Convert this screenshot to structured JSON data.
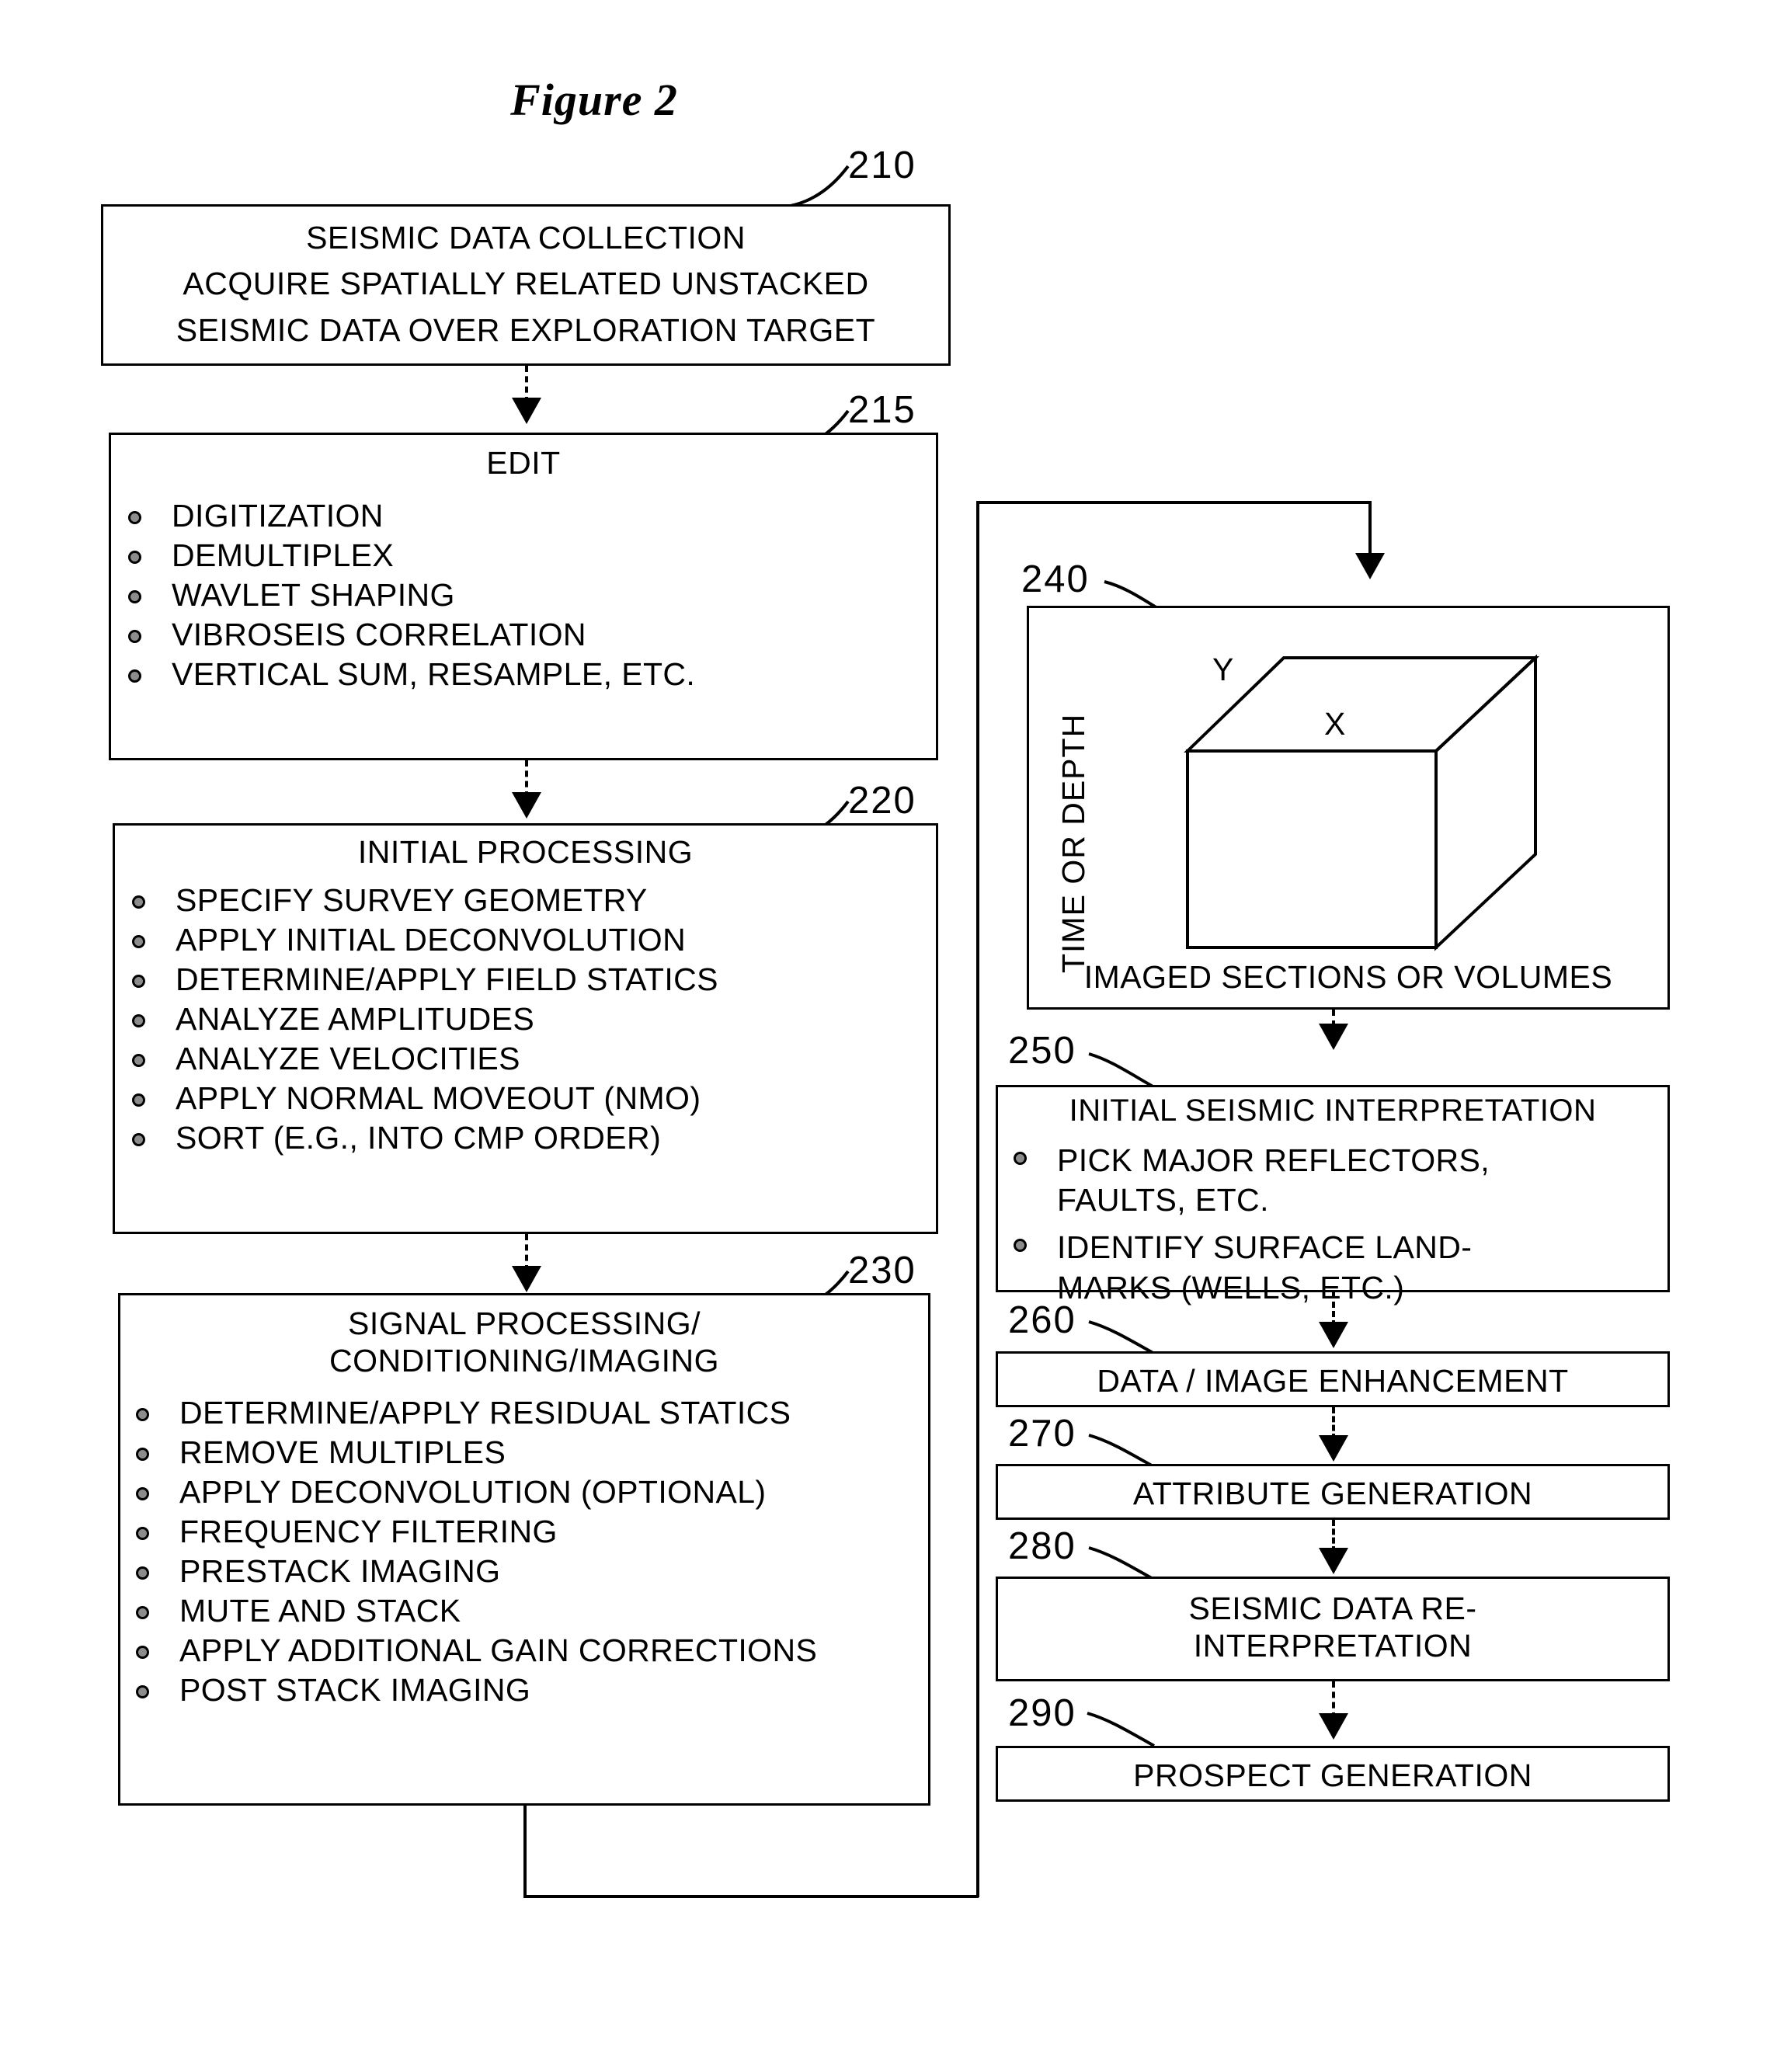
{
  "figure": {
    "title": "Figure 2"
  },
  "boxes": {
    "b210": {
      "ref": "210",
      "title": "SEISMIC DATA COLLECTION",
      "lines": [
        "ACQUIRE SPATIALLY RELATED UNSTACKED",
        "SEISMIC DATA OVER EXPLORATION TARGET"
      ]
    },
    "b215": {
      "ref": "215",
      "title": "EDIT",
      "items": [
        "DIGITIZATION",
        "DEMULTIPLEX",
        "WAVLET SHAPING",
        "VIBROSEIS CORRELATION",
        "VERTICAL SUM, RESAMPLE, ETC."
      ]
    },
    "b220": {
      "ref": "220",
      "title": "INITIAL PROCESSING",
      "items": [
        "SPECIFY SURVEY GEOMETRY",
        "APPLY INITIAL DECONVOLUTION",
        "DETERMINE/APPLY FIELD STATICS",
        "ANALYZE AMPLITUDES",
        "ANALYZE VELOCITIES",
        "APPLY NORMAL MOVEOUT (NMO)",
        "SORT (E.G., INTO CMP ORDER)"
      ]
    },
    "b230": {
      "ref": "230",
      "title": "SIGNAL PROCESSING/\nCONDITIONING/IMAGING",
      "items": [
        "DETERMINE/APPLY RESIDUAL STATICS",
        "REMOVE MULTIPLES",
        "APPLY DECONVOLUTION (OPTIONAL)",
        "FREQUENCY FILTERING",
        "PRESTACK IMAGING",
        "MUTE AND STACK",
        "APPLY ADDITIONAL GAIN CORRECTIONS",
        "POST STACK IMAGING"
      ]
    },
    "b240": {
      "ref": "240",
      "caption": "IMAGED SECTIONS OR VOLUMES",
      "vertical_axis_label": "TIME OR DEPTH",
      "axis_y": "Y",
      "axis_x": "X"
    },
    "b250": {
      "ref": "250",
      "title": "INITIAL SEISMIC INTERPRETATION",
      "items": [
        "PICK MAJOR REFLECTORS,\nFAULTS, ETC.",
        "IDENTIFY SURFACE LAND-\nMARKS (WELLS, ETC.)"
      ]
    },
    "b260": {
      "ref": "260",
      "title": "DATA / IMAGE ENHANCEMENT"
    },
    "b270": {
      "ref": "270",
      "title": "ATTRIBUTE GENERATION"
    },
    "b280": {
      "ref": "280",
      "title": "SEISMIC DATA RE-\nINTERPRETATION"
    },
    "b290": {
      "ref": "290",
      "title": "PROSPECT GENERATION"
    }
  },
  "colors": {
    "stroke": "#000000",
    "background": "#ffffff"
  }
}
